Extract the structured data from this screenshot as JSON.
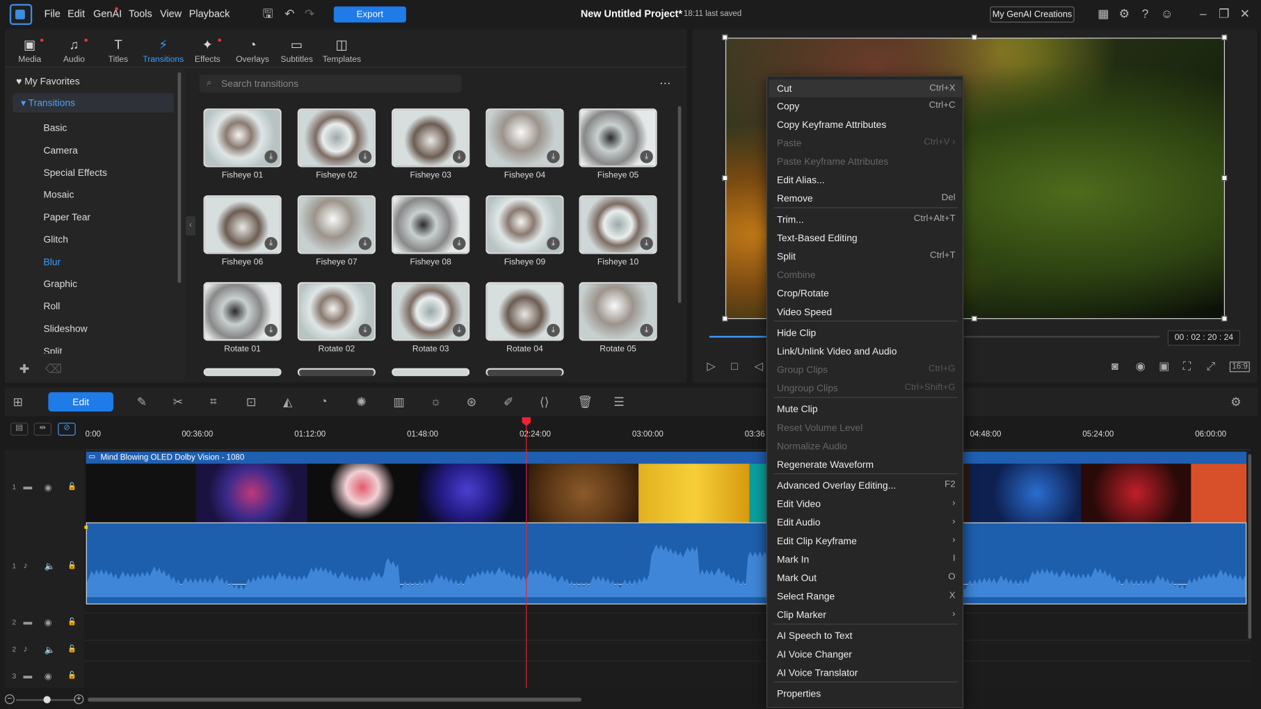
{
  "titlebar": {
    "menus": [
      "File",
      "Edit",
      "GenAI",
      "Tools",
      "View",
      "Playback"
    ],
    "export_label": "Export",
    "project_title": "New Untitled Project*",
    "saved_text": "18:11 last saved",
    "genai_label": "My GenAI Creations"
  },
  "modules": [
    {
      "label": "Media",
      "icon": "media-icon"
    },
    {
      "label": "Audio",
      "icon": "audio-icon"
    },
    {
      "label": "Titles",
      "icon": "titles-icon"
    },
    {
      "label": "Transitions",
      "icon": "transitions-icon"
    },
    {
      "label": "Effects",
      "icon": "effects-icon"
    },
    {
      "label": "Overlays",
      "icon": "overlays-icon"
    },
    {
      "label": "Subtitles",
      "icon": "subtitles-icon"
    },
    {
      "label": "Templates",
      "icon": "templates-icon"
    }
  ],
  "library": {
    "favorites": "My Favorites",
    "category_header": "Transitions",
    "categories": [
      "Basic",
      "Camera",
      "Special Effects",
      "Mosaic",
      "Paper Tear",
      "Glitch",
      "Blur",
      "Graphic",
      "Roll",
      "Slideshow",
      "Split"
    ],
    "selected_category": "Blur",
    "search_placeholder": "Search transitions",
    "items": [
      "Fisheye 01",
      "Fisheye 02",
      "Fisheye 03",
      "Fisheye 04",
      "Fisheye 05",
      "Fisheye 06",
      "Fisheye 07",
      "Fisheye 08",
      "Fisheye 09",
      "Fisheye 10",
      "Rotate 01",
      "Rotate 02",
      "Rotate 03",
      "Rotate 04",
      "Rotate 05"
    ]
  },
  "preview": {
    "timecode": "00 : 02 : 20 : 24"
  },
  "edit_toolbar": {
    "edit_label": "Edit"
  },
  "timeline": {
    "ticks": [
      "0:00",
      "00:36:00",
      "01:12:00",
      "01:48:00",
      "02:24:00",
      "03:00:00",
      "03:36",
      "04:48:00",
      "05:24:00",
      "06:00:00"
    ],
    "clip_name": "Mind Blowing OLED Dolby Vision - 1080",
    "track_numbers": [
      "1",
      "1",
      "2",
      "2",
      "3"
    ]
  },
  "context_menu": [
    {
      "label": "Cut",
      "shortcut": "Ctrl+X",
      "state": "highlighted"
    },
    {
      "label": "Copy",
      "shortcut": "Ctrl+C",
      "state": "enabled"
    },
    {
      "label": "Copy Keyframe Attributes",
      "shortcut": "",
      "state": "enabled"
    },
    {
      "label": "Paste",
      "shortcut": "Ctrl+V",
      "state": "disabled",
      "sub": true
    },
    {
      "label": "Paste Keyframe Attributes",
      "shortcut": "",
      "state": "disabled"
    },
    {
      "label": "Edit Alias...",
      "shortcut": "",
      "state": "enabled"
    },
    {
      "label": "Remove",
      "shortcut": "Del",
      "state": "enabled"
    },
    {
      "label": "Trim...",
      "shortcut": "Ctrl+Alt+T",
      "state": "enabled"
    },
    {
      "label": "Text-Based Editing",
      "shortcut": "",
      "state": "enabled"
    },
    {
      "label": "Split",
      "shortcut": "Ctrl+T",
      "state": "enabled"
    },
    {
      "label": "Combine",
      "shortcut": "",
      "state": "disabled"
    },
    {
      "label": "Crop/Rotate",
      "shortcut": "",
      "state": "enabled"
    },
    {
      "label": "Video Speed",
      "shortcut": "",
      "state": "enabled"
    },
    {
      "label": "Hide Clip",
      "shortcut": "",
      "state": "enabled"
    },
    {
      "label": "Link/Unlink Video and Audio",
      "shortcut": "",
      "state": "enabled"
    },
    {
      "label": "Group Clips",
      "shortcut": "Ctrl+G",
      "state": "disabled"
    },
    {
      "label": "Ungroup Clips",
      "shortcut": "Ctrl+Shift+G",
      "state": "disabled"
    },
    {
      "label": "Mute Clip",
      "shortcut": "",
      "state": "enabled"
    },
    {
      "label": "Reset Volume Level",
      "shortcut": "",
      "state": "disabled"
    },
    {
      "label": "Normalize Audio",
      "shortcut": "",
      "state": "disabled"
    },
    {
      "label": "Regenerate Waveform",
      "shortcut": "",
      "state": "enabled"
    },
    {
      "label": "Advanced Overlay Editing...",
      "shortcut": "F2",
      "state": "enabled"
    },
    {
      "label": "Edit Video",
      "shortcut": "›",
      "state": "enabled"
    },
    {
      "label": "Edit Audio",
      "shortcut": "›",
      "state": "enabled"
    },
    {
      "label": "Edit Clip Keyframe",
      "shortcut": "›",
      "state": "enabled"
    },
    {
      "label": "Mark In",
      "shortcut": "I",
      "state": "enabled"
    },
    {
      "label": "Mark Out",
      "shortcut": "O",
      "state": "enabled"
    },
    {
      "label": "Select Range",
      "shortcut": "X",
      "state": "enabled"
    },
    {
      "label": "Clip Marker",
      "shortcut": "›",
      "state": "enabled"
    },
    {
      "label": "AI Speech to Text",
      "shortcut": "",
      "state": "enabled"
    },
    {
      "label": "AI Voice Changer",
      "shortcut": "",
      "state": "enabled"
    },
    {
      "label": "AI Voice Translator",
      "shortcut": "",
      "state": "enabled"
    },
    {
      "label": "Properties",
      "shortcut": "",
      "state": "enabled"
    }
  ]
}
